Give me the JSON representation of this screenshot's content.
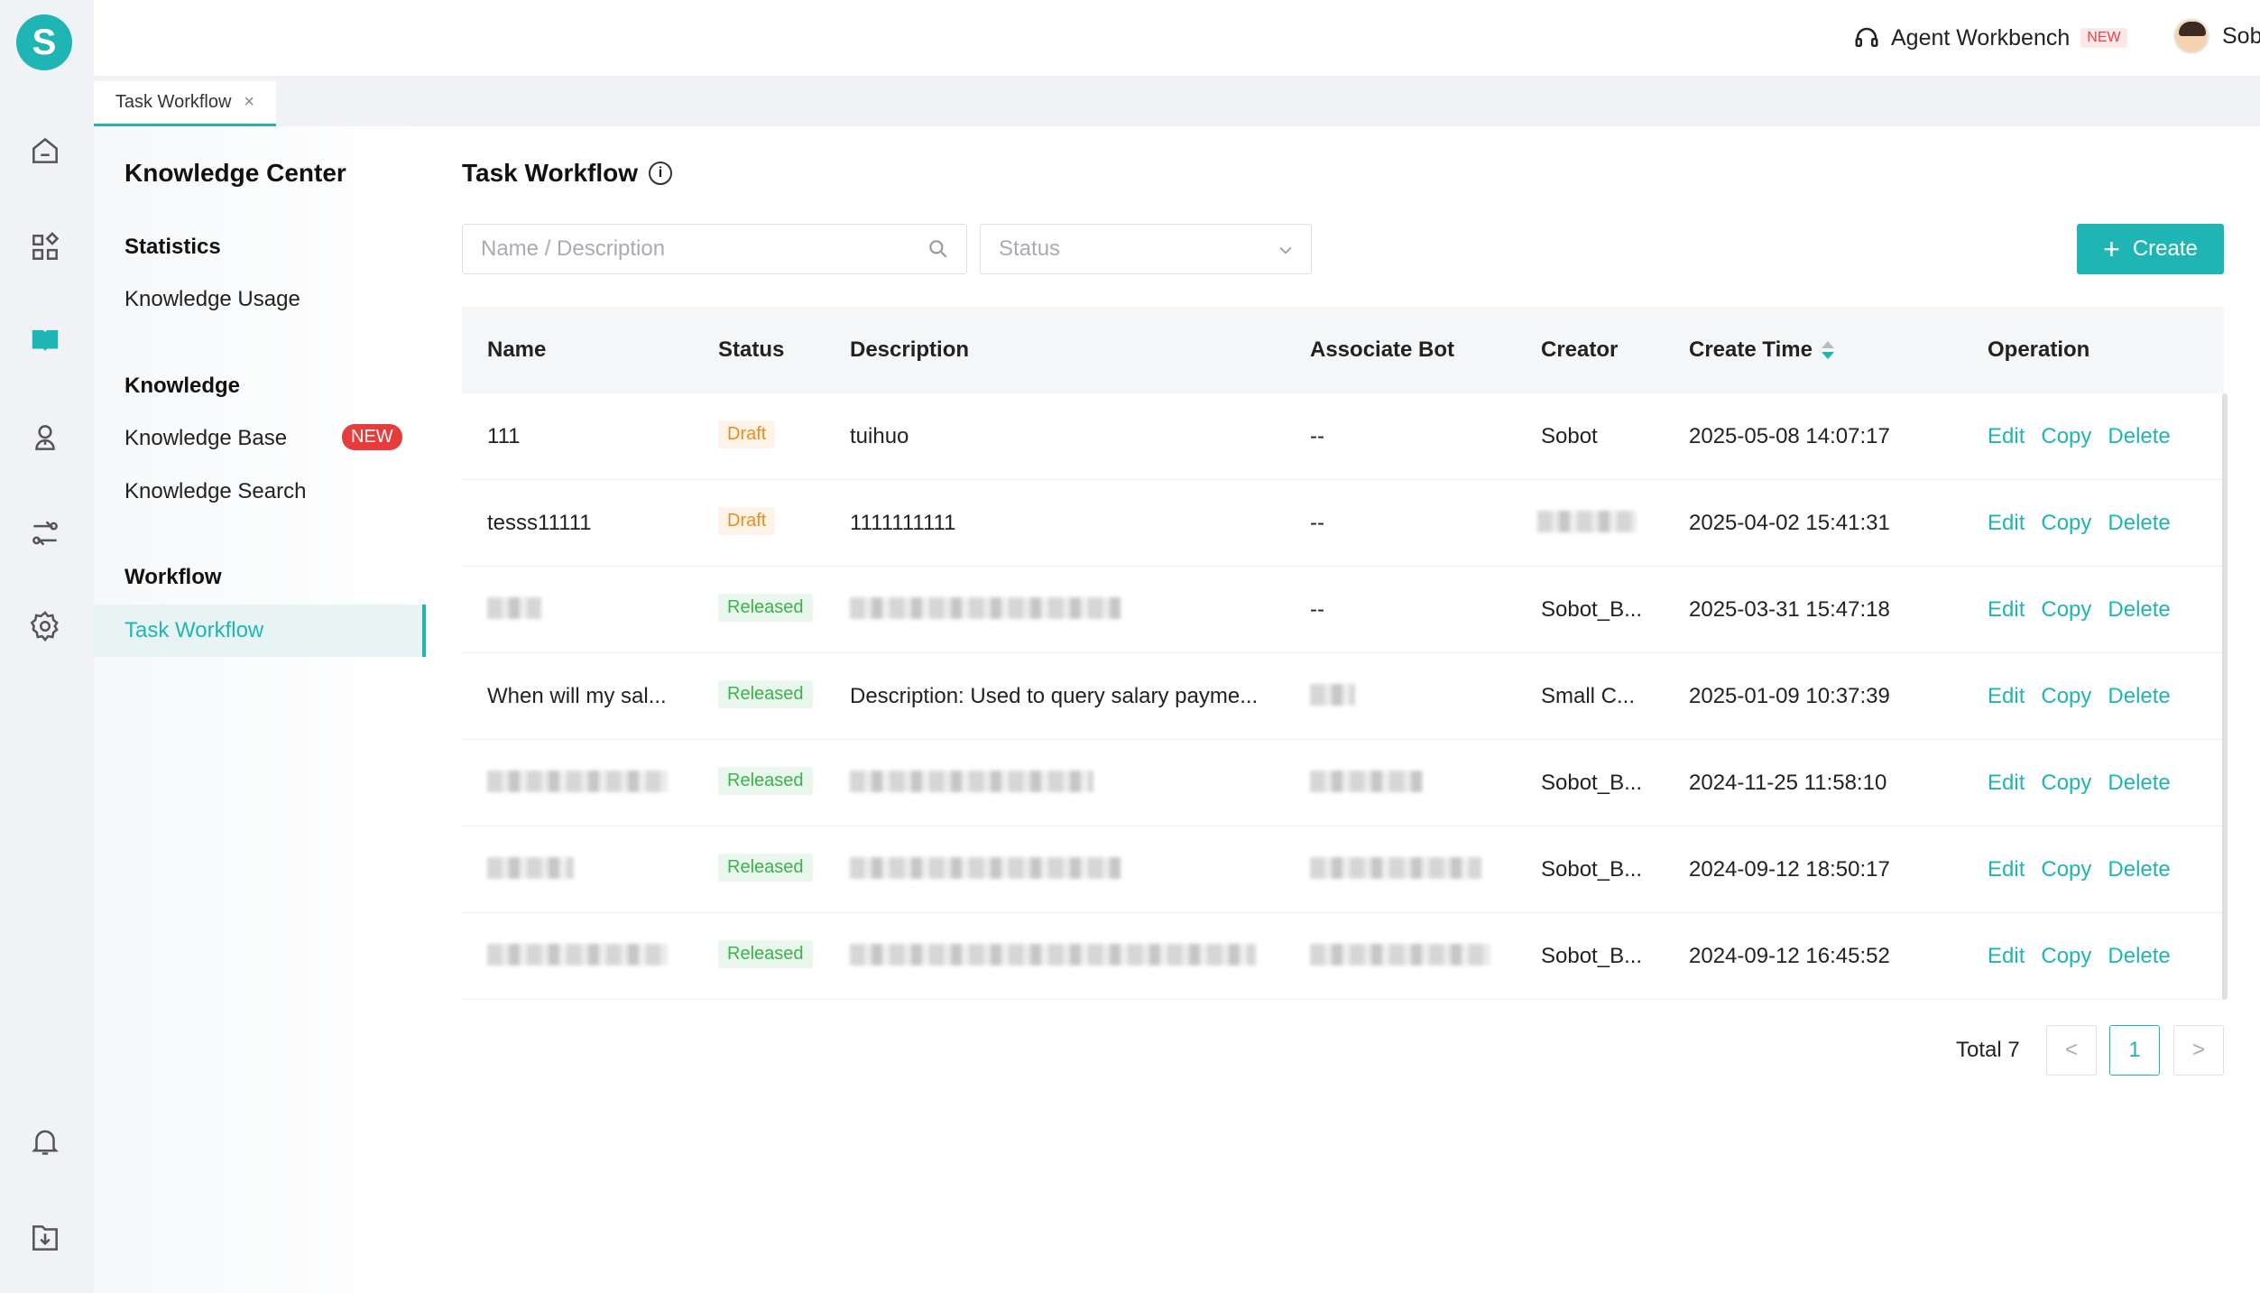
{
  "app": {
    "logo_letter": "S"
  },
  "header": {
    "agent_workbench": "Agent Workbench",
    "new_badge": "NEW",
    "user_name": "Sobot"
  },
  "tabs": [
    {
      "label": "Task Workflow",
      "close": "×"
    }
  ],
  "sidebar": {
    "title": "Knowledge Center",
    "groups": [
      {
        "label": "Statistics",
        "items": [
          {
            "label": "Knowledge Usage"
          }
        ]
      },
      {
        "label": "Knowledge",
        "items": [
          {
            "label": "Knowledge Base",
            "badge": "NEW"
          },
          {
            "label": "Knowledge Search"
          }
        ]
      },
      {
        "label": "Workflow",
        "items": [
          {
            "label": "Task Workflow",
            "active": true
          }
        ]
      }
    ]
  },
  "main": {
    "title": "Task Workflow",
    "info": "i",
    "search_placeholder": "Name / Description",
    "status_placeholder": "Status",
    "create_label": "Create",
    "columns": [
      "Name",
      "Status",
      "Description",
      "Associate Bot",
      "Creator",
      "Create Time",
      "Operation"
    ],
    "rows": [
      {
        "name": "111",
        "status": "Draft",
        "description": "tuihuo",
        "bot": "--",
        "creator": "Sobot",
        "time": "2025-05-08 14:07:17"
      },
      {
        "name": "tesss11111",
        "status": "Draft",
        "description": "1111111111",
        "bot": "--",
        "creator": "",
        "time": "2025-04-02 15:41:31"
      },
      {
        "name": "",
        "status": "Released",
        "description": "",
        "bot": "--",
        "creator": "Sobot_B...",
        "time": "2025-03-31 15:47:18"
      },
      {
        "name": "When will my sal...",
        "status": "Released",
        "description": "Description: Used to query salary payme...",
        "bot": "",
        "creator": "Small C...",
        "time": "2025-01-09 10:37:39"
      },
      {
        "name": "",
        "status": "Released",
        "description": "",
        "bot": "",
        "creator": "Sobot_B...",
        "time": "2024-11-25 11:58:10"
      },
      {
        "name": "",
        "status": "Released",
        "description": "",
        "bot": "",
        "creator": "Sobot_B...",
        "time": "2024-09-12 18:50:17"
      },
      {
        "name": "",
        "status": "Released",
        "description": "",
        "bot": "",
        "creator": "Sobot_B...",
        "time": "2024-09-12 16:45:52"
      }
    ],
    "operations": {
      "edit": "Edit",
      "copy": "Copy",
      "delete": "Delete"
    },
    "pagination": {
      "total_label": "Total 7",
      "current_page": "1",
      "prev": "<",
      "next": ">"
    }
  },
  "colors": {
    "accent": "#1fb5b5",
    "draft": "#f08c1c",
    "released": "#3bb34a",
    "new": "#e63c3c"
  },
  "icons": [
    "home-icon",
    "apps-icon",
    "book-icon",
    "user-icon",
    "flow-icon",
    "settings-icon",
    "bell-icon",
    "download-icon",
    "search-icon",
    "chevron-down-icon",
    "info-icon",
    "plus-icon",
    "headset-icon",
    "close-icon"
  ]
}
